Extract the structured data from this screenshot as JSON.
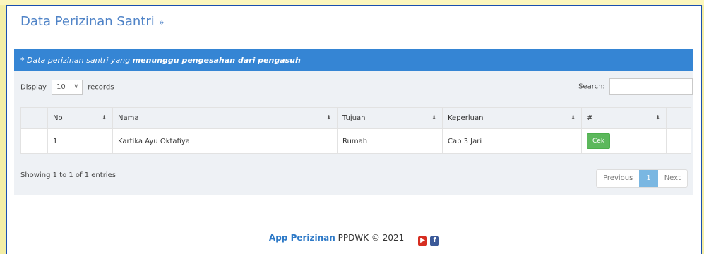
{
  "page": {
    "title": "Data Perizinan Santri",
    "title_suffix": "»"
  },
  "box": {
    "header_prefix": "* Data perizinan santri yang ",
    "header_emphasis": "menunggu pengesahan dari pengasuh"
  },
  "controls": {
    "display_label": "Display",
    "page_size": "10",
    "records_label": "records",
    "search_label": "Search:",
    "search_value": ""
  },
  "table": {
    "columns": [
      "No",
      "Nama",
      "Tujuan",
      "Keperluan",
      "#"
    ],
    "rows": [
      {
        "no": "1",
        "nama": "Kartika Ayu Oktafiya",
        "tujuan": "Rumah",
        "keperluan": "Cap 3 Jari",
        "action": "Cek"
      }
    ]
  },
  "pagination": {
    "info": "Showing 1 to 1 of 1 entries",
    "previous": "Previous",
    "current": "1",
    "next": "Next"
  },
  "footer": {
    "app_name": "App Perizinan",
    "rest": " PPDWK © 2021",
    "icons": [
      "youtube-icon",
      "facebook-icon"
    ]
  },
  "colors": {
    "header_blue": "#3585d4",
    "title_blue": "#4f83c7",
    "button_green": "#5cb85c",
    "page_active": "#7ab7e2",
    "frame_border": "#1a4fb0",
    "background_yellow": "#f3eea6"
  }
}
